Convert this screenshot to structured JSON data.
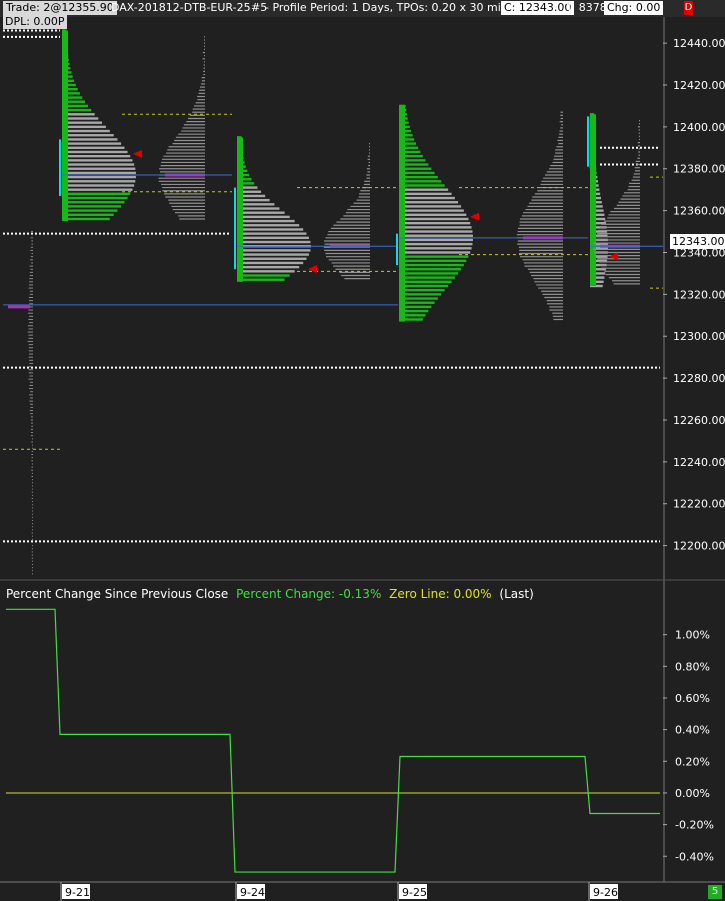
{
  "header": {
    "trade": "Trade: 2@12355.90",
    "instrument": "DAX-201812-DTB-EUR-25",
    "chart_id": "#5",
    "profile_info": "- Profile Period: 1 Days, TPOs: 0.20 x 30 min",
    "close": "C: 12343.00",
    "ticks": "T: 8378",
    "change": "Chg: 0.00",
    "change_flag": "D",
    "dpl": "DPL: 0.00P"
  },
  "indicator": {
    "title": "Percent Change Since Previous Close",
    "pct_label": "Percent Change: -0.13%",
    "zero_label": "Zero Line: 0.00%",
    "mode": "(Last)"
  },
  "last_price_tag": "12343.00",
  "corner_badge": "5",
  "colors": {
    "background": "#202020",
    "profile_gray": "#a8a8a8",
    "tpo_green": "#18b818",
    "value_line": "#c8c81e",
    "poc_line": "#3a6ed8",
    "vpoc": "#b030b0",
    "ib_line": "#00e0e8",
    "marker_red": "#e00000",
    "pct_line": "#44dd44",
    "zero_line": "#e0e020"
  },
  "chart_data": [
    {
      "type": "line",
      "name": "price_axis",
      "ylim": [
        12185,
        12452
      ],
      "yticks": [
        12200,
        12220,
        12240,
        12260,
        12280,
        12300,
        12320,
        12340,
        12360,
        12380,
        12400,
        12420,
        12440
      ],
      "tick_labels": [
        "12200.00",
        "12220.00",
        "12240.00",
        "12260.00",
        "12280.00",
        "12300.00",
        "12320.00",
        "12340.00",
        "12360.00",
        "12380.00",
        "12400.00",
        "12420.00",
        "12440.00"
      ],
      "sessions": [
        {
          "date": "9-21",
          "high": 12446,
          "low": 12355,
          "poc": 12377,
          "vah": 12406,
          "val": 12369,
          "ib_high": 12394,
          "ib_low": 12367
        },
        {
          "date": "9-24",
          "high": 12395,
          "low": 12326,
          "poc": 12343,
          "vah": 12371,
          "val": 12331,
          "ib_high": 12371,
          "ib_low": 12332
        },
        {
          "date": "9-25",
          "high": 12410,
          "low": 12307,
          "poc": 12347,
          "vah": 12371,
          "val": 12339,
          "ib_high": 12349,
          "ib_low": 12334
        },
        {
          "date": "9-26",
          "high": 12406,
          "low": 12324,
          "poc": 12343,
          "vah": 12376,
          "val": 12323,
          "ib_high": 12405,
          "ib_low": 12381
        }
      ],
      "dotted_levels": [
        12446,
        12443,
        12349,
        12285,
        12202,
        12390,
        12382
      ]
    },
    {
      "type": "line",
      "name": "Percent Change",
      "categories": [
        "9-21",
        "9-24",
        "9-25",
        "9-26"
      ],
      "segments": [
        {
          "from_date": "9-20",
          "value": 1.16
        },
        {
          "from_date": "9-21",
          "value": 0.37
        },
        {
          "from_date": "9-24",
          "value": -0.5
        },
        {
          "from_date": "9-25",
          "value": 0.23
        },
        {
          "from_date": "9-26",
          "value": -0.13
        }
      ],
      "zero_line": 0.0,
      "ylim": [
        -0.55,
        1.2
      ],
      "yticks": [
        -0.4,
        -0.2,
        0.0,
        0.2,
        0.4,
        0.6,
        0.8,
        1.0
      ],
      "tick_labels": [
        "-0.40%",
        "-0.20%",
        "0.00%",
        "0.20%",
        "0.40%",
        "0.60%",
        "0.80%",
        "1.00%"
      ]
    }
  ],
  "date_labels": [
    "9-21",
    "9-24",
    "9-25",
    "9-26"
  ]
}
